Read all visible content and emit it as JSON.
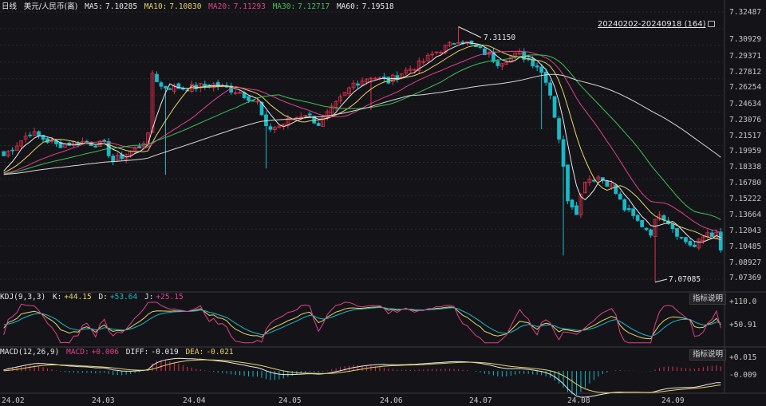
{
  "header": {
    "period": "日线",
    "symbol": "美元/人民币(离)",
    "ma": [
      {
        "label": "MA5:",
        "value": "7.10285",
        "color": "#e8e8e8"
      },
      {
        "label": "MA10:",
        "value": "7.10830",
        "color": "#e8d36a"
      },
      {
        "label": "MA20:",
        "value": "7.11293",
        "color": "#e0408a"
      },
      {
        "label": "MA30:",
        "value": "7.12717",
        "color": "#3fbf5a"
      },
      {
        "label": "MA60:",
        "value": "7.19518",
        "color": "#e8e8e8"
      }
    ]
  },
  "range_label": "20240202-20240918 (164)",
  "annotations": {
    "high": "7.31150",
    "low": "7.07085"
  },
  "kdj": {
    "title": "KDJ(9,3,3)",
    "k_label": "K:",
    "k_value": "+44.15",
    "d_label": "D:",
    "d_value": "+53.64",
    "j_label": "J:",
    "j_value": "+25.15",
    "button": "指标说明",
    "ticks": [
      "+110.0",
      "+50.91"
    ]
  },
  "macd": {
    "title": "MACD(12,26,9)",
    "macd_label": "MACD:",
    "macd_value": "+0.006",
    "diff_label": "DIFF:",
    "diff_value": "-0.019",
    "dea_label": "DEA:",
    "dea_value": "-0.021",
    "button": "指标说明",
    "ticks": [
      "+0.015",
      "-0.009"
    ]
  },
  "colors": {
    "up": "#e0304a",
    "down": "#19b9c8",
    "background": "#141418"
  },
  "chart_data": {
    "type": "candlestick",
    "y_ticks": [
      "7.32487",
      "7.30929",
      "7.29371",
      "7.27812",
      "7.26254",
      "7.24634",
      "7.23076",
      "7.21517",
      "7.19959",
      "7.18338",
      "7.16780",
      "7.15222",
      "7.13664",
      "7.12043",
      "7.10485",
      "7.08927",
      "7.07369"
    ],
    "ylim": [
      7.07,
      7.325
    ],
    "x_ticks": [
      "24.02",
      "24.03",
      "24.04",
      "24.05",
      "24.06",
      "24.07",
      "24.08",
      "24.09"
    ],
    "anchors": [
      [
        0,
        7.19
      ],
      [
        6,
        7.212
      ],
      [
        12,
        7.2
      ],
      [
        18,
        7.203
      ],
      [
        23,
        7.2
      ],
      [
        25,
        7.185
      ],
      [
        30,
        7.196
      ],
      [
        33,
        7.208
      ],
      [
        34,
        7.268
      ],
      [
        36,
        7.255
      ],
      [
        42,
        7.254
      ],
      [
        48,
        7.257
      ],
      [
        54,
        7.25
      ],
      [
        58,
        7.24
      ],
      [
        60,
        7.215
      ],
      [
        63,
        7.218
      ],
      [
        66,
        7.225
      ],
      [
        69,
        7.23
      ],
      [
        72,
        7.22
      ],
      [
        76,
        7.238
      ],
      [
        80,
        7.258
      ],
      [
        84,
        7.265
      ],
      [
        88,
        7.26
      ],
      [
        91,
        7.268
      ],
      [
        95,
        7.276
      ],
      [
        99,
        7.288
      ],
      [
        102,
        7.294
      ],
      [
        104,
        7.3
      ],
      [
        106,
        7.296
      ],
      [
        110,
        7.287
      ],
      [
        113,
        7.278
      ],
      [
        116,
        7.283
      ],
      [
        118,
        7.286
      ],
      [
        122,
        7.275
      ],
      [
        124,
        7.262
      ],
      [
        125,
        7.248
      ],
      [
        126,
        7.228
      ],
      [
        127,
        7.207
      ],
      [
        128,
        7.178
      ],
      [
        129,
        7.15
      ],
      [
        131,
        7.138
      ],
      [
        133,
        7.168
      ],
      [
        136,
        7.17
      ],
      [
        139,
        7.162
      ],
      [
        142,
        7.14
      ],
      [
        145,
        7.128
      ],
      [
        148,
        7.118
      ],
      [
        150,
        7.137
      ],
      [
        152,
        7.128
      ],
      [
        155,
        7.112
      ],
      [
        158,
        7.104
      ],
      [
        161,
        7.118
      ],
      [
        163,
        7.115
      ],
      [
        164,
        7.1
      ]
    ],
    "ma5": "7.10285",
    "ma10": "7.10830",
    "ma20": "7.11293",
    "ma30": "7.12717",
    "ma60": "7.19518",
    "kdj_latest": {
      "K": 44.15,
      "D": 53.64,
      "J": 25.15
    },
    "macd_latest": {
      "MACD": 0.006,
      "DIFF": -0.019,
      "DEA": -0.021
    }
  }
}
